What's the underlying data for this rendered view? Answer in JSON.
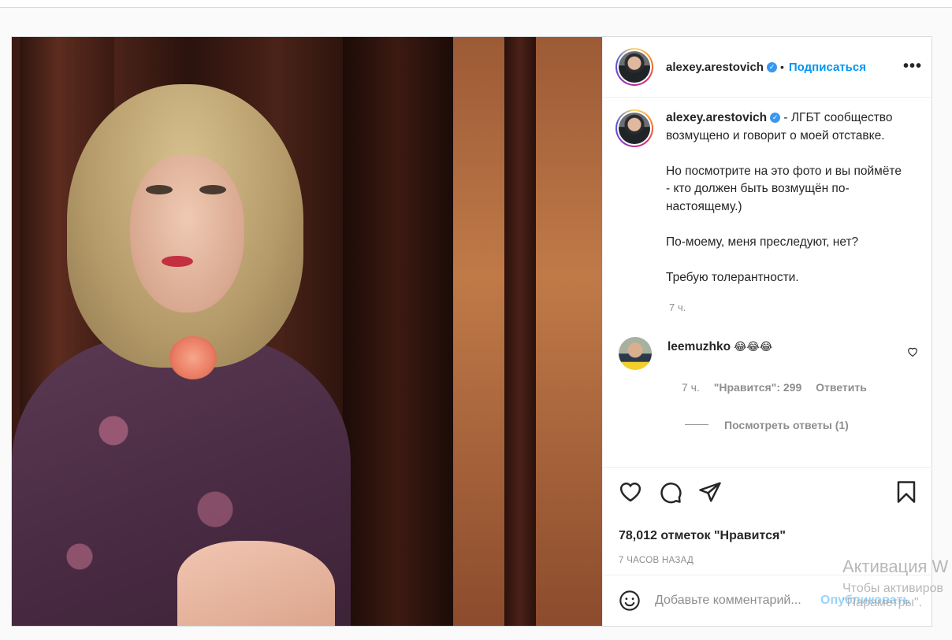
{
  "post": {
    "author": {
      "username": "alexey.arestovich",
      "follow_label": "Подписаться",
      "more_label": "•••"
    },
    "caption": {
      "username": "alexey.arestovich",
      "paragraphs": [
        "- ЛГБТ сообщество возмущено и говорит о моей отставке.",
        "Но посмотрите на это фото и вы поймёте - кто должен быть возмущён по-настоящему.)",
        "По-моему, меня преследуют, нет?",
        "Требую толерантности."
      ],
      "time": "7 ч."
    },
    "comment": {
      "username": "leemuzhko",
      "text": "😂😂😂",
      "time": "7 ч.",
      "likes": "\"Нравится\": 299",
      "reply_label": "Ответить",
      "view_replies": "Посмотреть ответы (1)"
    },
    "likes_count": "78,012 отметок \"Нравится\"",
    "posted_ago": "7 ЧАСОВ НАЗАД",
    "add_comment": {
      "placeholder": "Добавьте комментарий...",
      "publish_label": "Опубликовать"
    },
    "colors": {
      "accent": "#0095f6",
      "secondary_text": "#8e8e8e"
    }
  },
  "watermark": {
    "title": "Активация W",
    "line1": "Чтобы активиров",
    "line2": "\"Параметры\"."
  }
}
